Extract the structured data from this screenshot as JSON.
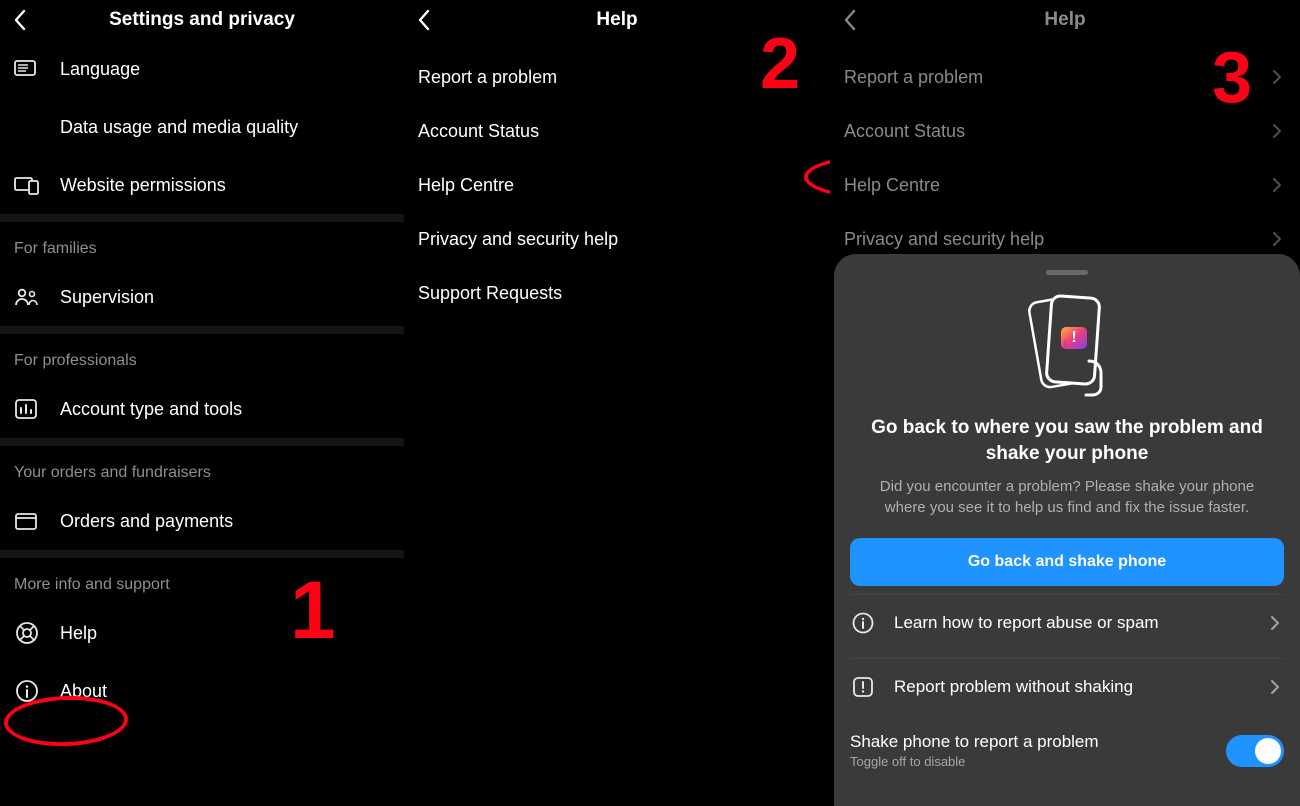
{
  "annotations": {
    "n1": "1",
    "n2": "2",
    "n3": "3"
  },
  "panel1": {
    "title": "Settings and privacy",
    "items": {
      "language": "Language",
      "data_usage": "Data usage and media quality",
      "website_permissions": "Website permissions"
    },
    "families_header": "For families",
    "families": {
      "supervision": "Supervision"
    },
    "pros_header": "For professionals",
    "pros": {
      "account_type": "Account type and tools"
    },
    "orders_header": "Your orders and fundraisers",
    "orders": {
      "orders_payments": "Orders and payments"
    },
    "moreinfo_header": "More info and support",
    "moreinfo": {
      "help": "Help",
      "about": "About"
    }
  },
  "panel2": {
    "title": "Help",
    "items": {
      "report": "Report a problem",
      "account_status": "Account Status",
      "help_centre": "Help Centre",
      "privacy_security": "Privacy and security help",
      "support_requests": "Support Requests"
    }
  },
  "panel3": {
    "title": "Help",
    "items": {
      "report": "Report a problem",
      "account_status": "Account Status",
      "help_centre": "Help Centre",
      "privacy_security": "Privacy and security help"
    },
    "sheet": {
      "heading": "Go back to where you saw the problem and shake your phone",
      "sub": "Did you encounter a problem? Please shake your phone where you see it to help us find and fix the issue faster.",
      "primary": "Go back and shake phone",
      "learn": "Learn how to report abuse or spam",
      "report_no_shake": "Report problem without shaking",
      "toggle_label": "Shake phone to report a problem",
      "toggle_hint": "Toggle off to disable"
    }
  }
}
